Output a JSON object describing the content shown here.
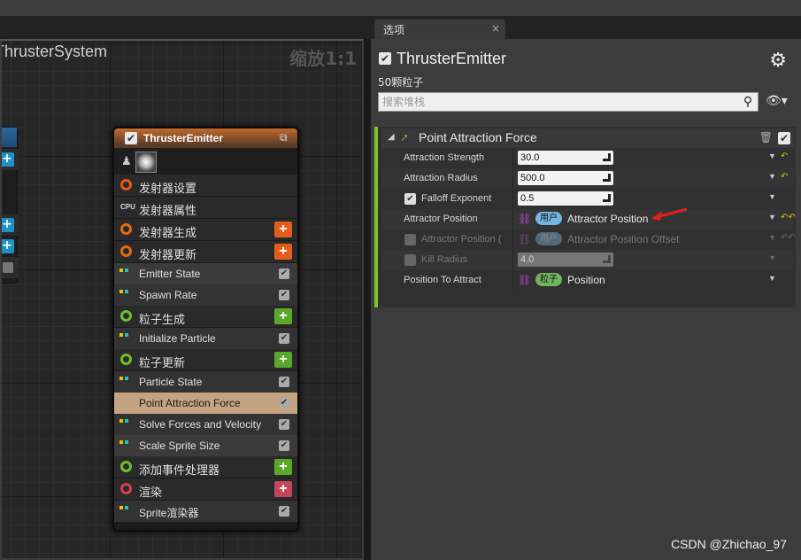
{
  "graph": {
    "title": "ThrusterSystem",
    "zoom": "缩放1:1"
  },
  "emitter": {
    "title": "ThrusterEmitter",
    "rows": [
      {
        "label": "发射器设置",
        "kind": "section",
        "icon_color": "#e05a1a"
      },
      {
        "label": "发射器属性",
        "kind": "section",
        "icon": "CPU"
      },
      {
        "label": "发射器生成",
        "kind": "section",
        "icon_color": "#e56a1a",
        "add": "+"
      },
      {
        "label": "发射器更新",
        "kind": "section",
        "icon_color": "#e56a1a",
        "add": "+"
      },
      {
        "label": "Emitter State",
        "kind": "module"
      },
      {
        "label": "Spawn Rate",
        "kind": "module"
      },
      {
        "label": "粒子生成",
        "kind": "section",
        "icon_color": "#6fbf2a",
        "add": "+"
      },
      {
        "label": "Initialize Particle",
        "kind": "module"
      },
      {
        "label": "粒子更新",
        "kind": "section",
        "icon_color": "#6fbf2a",
        "add": "+"
      },
      {
        "label": "Particle State",
        "kind": "module"
      },
      {
        "label": "Point Attraction Force",
        "kind": "module-highlight"
      },
      {
        "label": "Solve Forces and Velocity",
        "kind": "module"
      },
      {
        "label": "Scale Sprite Size",
        "kind": "module"
      },
      {
        "label": "添加事件处理器",
        "kind": "section",
        "icon_color": "#6fbf2a",
        "add": "+"
      },
      {
        "label": "渲染",
        "kind": "section",
        "icon_color": "#d0405a",
        "add": "+"
      },
      {
        "label": "Sprite渲染器",
        "kind": "module"
      }
    ]
  },
  "tab": {
    "label": "选项",
    "close": "×"
  },
  "panel": {
    "title": "ThrusterEmitter",
    "subtitle": "50颗粒子",
    "search_placeholder": "搜索堆栈",
    "module": {
      "name": "Point Attraction Force",
      "params": [
        {
          "name": "Attraction Strength",
          "value": "30.0",
          "type": "number"
        },
        {
          "name": "Attraction Radius",
          "value": "500.0",
          "type": "number"
        },
        {
          "name": "Falloff Exponent",
          "value": "0.5",
          "type": "number",
          "checkbox": true
        },
        {
          "name": "Attractor Position",
          "pill": "用户",
          "value": "Attractor Position",
          "type": "link"
        },
        {
          "name": "Attractor Position (",
          "pill": "用户",
          "value": "Attractor Position Offset",
          "type": "link",
          "disabled": true,
          "checkbox": true
        },
        {
          "name": "Kill Radius",
          "value": "4.0",
          "type": "number",
          "disabled": true,
          "checkbox": true
        },
        {
          "name": "Position To Attract",
          "pill": "粒子",
          "value": "Position",
          "type": "link"
        }
      ]
    }
  },
  "watermark": "CSDN @Zhichao_97",
  "colors": {
    "accent_green": "#7ec32a",
    "emitter_header": "#c26a2e",
    "highlight_row": "#c5a381",
    "add_orange": "#e25d1a",
    "add_green": "#5aa82a",
    "add_red": "#c0485a"
  }
}
